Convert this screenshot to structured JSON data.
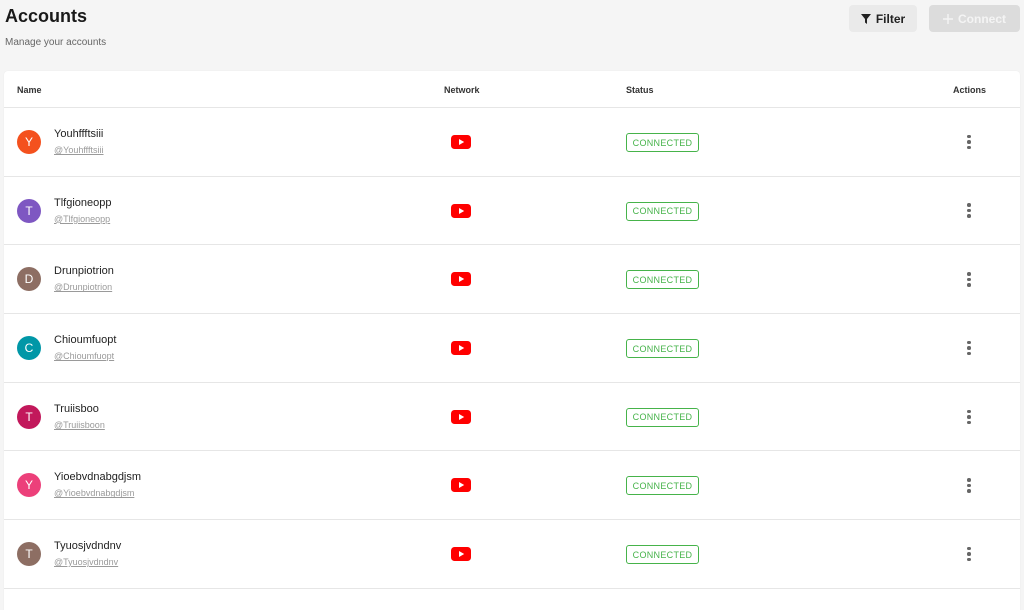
{
  "header": {
    "title": "Accounts",
    "subtitle": "Manage your accounts"
  },
  "toolbar": {
    "filter_label": "Filter",
    "connect_label": "Connect",
    "filter_icon": "filter-icon",
    "connect_icon": "plus-icon"
  },
  "table": {
    "columns": [
      "Name",
      "Network",
      "Status",
      "Actions"
    ],
    "rows": [
      {
        "initial": "Y",
        "name": "Youhffftsiii",
        "handle": "@Youhffftsiii",
        "status": "CONNECTED",
        "avatar_color": "#f4511e"
      },
      {
        "initial": "T",
        "name": "Tlfgioneopp",
        "handle": "@Tlfgioneopp",
        "status": "CONNECTED",
        "avatar_color": "#7e57c2"
      },
      {
        "initial": "D",
        "name": "Drunpiotrion",
        "handle": "@Drunpiotrion",
        "status": "CONNECTED",
        "avatar_color": "#8d6e63"
      },
      {
        "initial": "C",
        "name": "Chioumfuopt",
        "handle": "@Chioumfuopt",
        "status": "CONNECTED",
        "avatar_color": "#0097a7"
      },
      {
        "initial": "T",
        "name": "Truiisboo",
        "handle": "@Truiisboon",
        "status": "CONNECTED",
        "avatar_color": "#c2185b"
      },
      {
        "initial": "Y",
        "name": "Yioebvdnabgdjsm",
        "handle": "@Yioebvdnabgdjsm",
        "status": "CONNECTED",
        "avatar_color": "#ec407a"
      },
      {
        "initial": "T",
        "name": "Tyuosjvdndnv",
        "handle": "@Tyuosjvdndnv",
        "status": "CONNECTED",
        "avatar_color": "#8d6e63"
      }
    ]
  },
  "colors": {
    "youtube_red": "#ff0000",
    "connected_green": "#46b34a"
  }
}
